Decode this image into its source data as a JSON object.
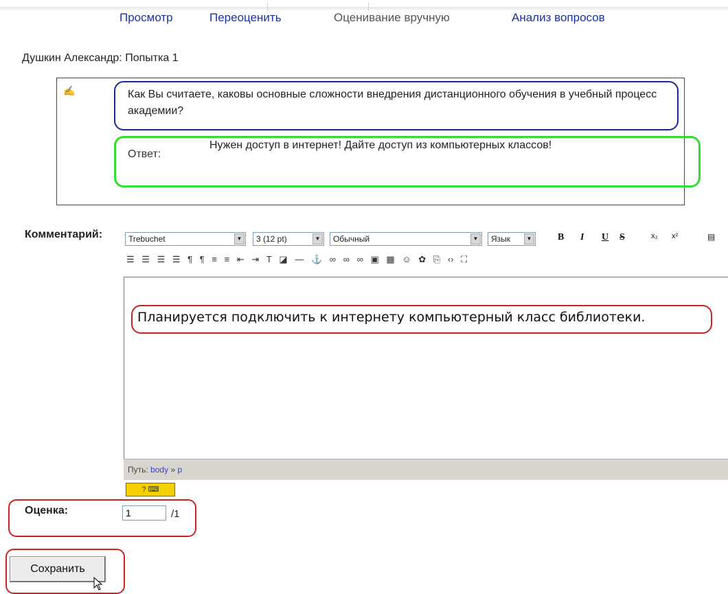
{
  "tabs": [
    {
      "label": "Просмотр",
      "active": false
    },
    {
      "label": "Переоценить",
      "active": false
    },
    {
      "label": "Оценивание вручную",
      "active": true
    },
    {
      "label": "Анализ вопросов",
      "active": false
    }
  ],
  "attempt_title": "Душкин Александр: Попытка 1",
  "question": {
    "icon": "essay-pencil-icon",
    "text": "Как Вы считаете, каковы основные сложности внедрения дистанционного обучения в учебный процесс академии?",
    "answer_label": "Ответ:",
    "answer_text": "Нужен доступ в интернет! Дайте доступ из компьютерных классов!"
  },
  "comment": {
    "label": "Комментарий:",
    "font_family": "Trebuchet",
    "font_size": "3 (12 pt)",
    "paragraph_style": "Обычный",
    "language": "Язык",
    "editor_text": "Планируется подключить к интернету компьютерный класс библиотеки.",
    "path_label": "Путь:",
    "path_body": "body",
    "path_sep": "»",
    "path_p": "p"
  },
  "grade": {
    "label": "Оценка:",
    "value": "1",
    "max": "/1"
  },
  "save_button": "Сохранить",
  "colors": {
    "link": "#1a33a0",
    "question_outline": "#1a2a8a",
    "answer_outline": "#33dd33",
    "highlight_outline": "#cc2222"
  }
}
